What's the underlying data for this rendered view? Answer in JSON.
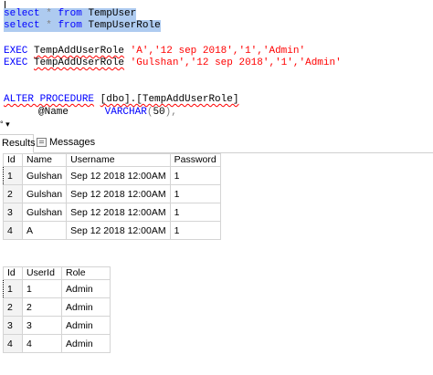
{
  "editor": {
    "lines": [
      {
        "kw1": "select",
        "op": "*",
        "kw2": "from",
        "ident": "TempUser"
      },
      {
        "kw1": "select",
        "op": "*",
        "kw2": "from",
        "ident": "TempUserRole"
      }
    ],
    "exec1": {
      "kw": "EXEC",
      "proc": "TempAddUserRole",
      "args": "'A','12 sep 2018','1','Admin'"
    },
    "exec2": {
      "kw": "EXEC",
      "proc": "TempAddUserRole",
      "args": "'Gulshan','12 sep 2018','1','Admin'"
    },
    "alter": {
      "kw": "ALTER PROCEDURE",
      "name": "[dbo].[TempAddUserRole]"
    },
    "param": {
      "name": "@Name",
      "type": "VARCHAR",
      "len": "50",
      "tail": "),"
    }
  },
  "zoom_label": "° ▾",
  "tabs": {
    "results": "Results",
    "messages": "Messages"
  },
  "grid1": {
    "columns": [
      "Id",
      "Name",
      "Username",
      "Password"
    ],
    "rows": [
      [
        "1",
        "1",
        "Gulshan",
        "Sep 12 2018 12:00AM",
        "1"
      ],
      [
        "2",
        "2",
        "Gulshan",
        "Sep 12 2018 12:00AM",
        "1"
      ],
      [
        "3",
        "3",
        "Gulshan",
        "Sep 12 2018 12:00AM",
        "1"
      ],
      [
        "4",
        "4",
        "A",
        "Sep 12 2018 12:00AM",
        "1"
      ]
    ]
  },
  "grid2": {
    "columns": [
      "Id",
      "UserId",
      "Role"
    ],
    "rows": [
      [
        "1",
        "1",
        "1",
        "Admin"
      ],
      [
        "2",
        "2",
        "2",
        "Admin"
      ],
      [
        "3",
        "3",
        "3",
        "Admin"
      ],
      [
        "4",
        "4",
        "4",
        "Admin"
      ]
    ]
  }
}
